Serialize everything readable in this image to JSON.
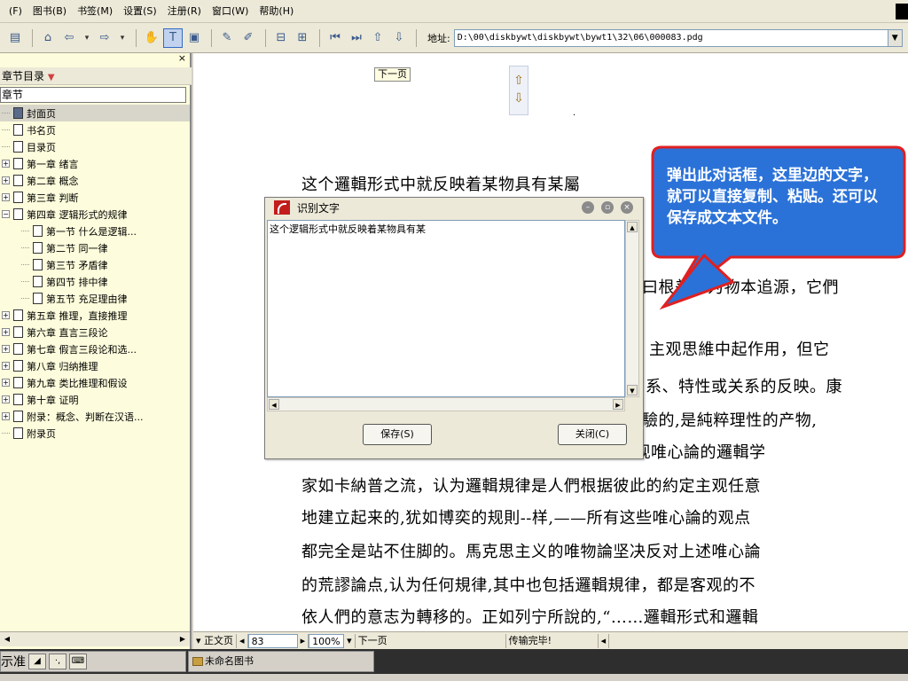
{
  "menu": {
    "items": [
      "(F)",
      "图书(B)",
      "书签(M)",
      "设置(S)",
      "注册(R)",
      "窗口(W)",
      "帮助(H)"
    ]
  },
  "toolbar": {
    "address_label": "地址:",
    "address_value": "D:\\00\\diskbywt\\diskbywt\\bywt1\\32\\06\\000083.pdg"
  },
  "left_panel": {
    "title": "章节目录",
    "header": "章节",
    "tree": [
      {
        "label": "封面页",
        "expandable": false,
        "level": 0,
        "selected": true
      },
      {
        "label": "书名页",
        "expandable": false,
        "level": 0
      },
      {
        "label": "目录页",
        "expandable": false,
        "level": 0
      },
      {
        "label": "第一章 绪言",
        "expandable": true,
        "level": 0
      },
      {
        "label": "第二章 概念",
        "expandable": true,
        "level": 0
      },
      {
        "label": "第三章 判断",
        "expandable": true,
        "level": 0
      },
      {
        "label": "第四章 逻辑形式的规律",
        "expandable": true,
        "expanded": true,
        "level": 0
      },
      {
        "label": "第一节 什么是逻辑...",
        "expandable": false,
        "level": 1
      },
      {
        "label": "第二节 同一律",
        "expandable": false,
        "level": 1
      },
      {
        "label": "第三节 矛盾律",
        "expandable": false,
        "level": 1
      },
      {
        "label": "第四节 排中律",
        "expandable": false,
        "level": 1
      },
      {
        "label": "第五节 充足理由律",
        "expandable": false,
        "level": 1
      },
      {
        "label": "第五章 推理，直接推理",
        "expandable": true,
        "level": 0
      },
      {
        "label": "第六章 直言三段论",
        "expandable": true,
        "level": 0
      },
      {
        "label": "第七章 假言三段论和选...",
        "expandable": true,
        "level": 0
      },
      {
        "label": "第八章 归纳推理",
        "expandable": true,
        "level": 0
      },
      {
        "label": "第九章 类比推理和假设",
        "expandable": true,
        "level": 0
      },
      {
        "label": "第十章 证明",
        "expandable": true,
        "level": 0
      },
      {
        "label": "附录：概念、判断在汉语...",
        "expandable": true,
        "level": 0
      },
      {
        "label": "附录页",
        "expandable": false,
        "level": 0
      }
    ]
  },
  "document": {
    "next_page_hint": "下一页",
    "lines": [
      "这个邏輯形式中就反映着某物具有某屬",
      "曰根差，为物本追源，它們",
      "主观思維中起作用，但它",
      "系、特性或关系的反映。康",
      "驗的,是純粹理性的产物,",
      "級的主观唯心論的邏輯学",
      "家如卡納普之流，认为邏輯規律是人們根据彼此的約定主观任意",
      "地建立起来的,犹如博奕的规則--样,——所有这些唯心論的观点",
      "都完全是站不住脚的。馬克思主义的唯物論坚决反对上述唯心論",
      "的荒謬論点,认为任何規律,其中也包括邏輯規律，都是客观的不",
      "依人們的意志为轉移的。正如列宁所說的,“……邏輯形式和邏輯"
    ]
  },
  "dialog": {
    "title": "识别文字",
    "text": "这个逻辑形式中就反映着某物具有某",
    "save_label": "保存(S)",
    "close_label": "关闭(C)"
  },
  "callout": {
    "text": "弹出此对话框，这里边的文字，就可以直接复制、粘贴。还可以保存成文本文件。",
    "fill_color": "#2b72d8",
    "border_color": "#e02020"
  },
  "statusbar": {
    "mode": "正文页",
    "page": "83",
    "zoom": "100%",
    "next": "下一页",
    "status_text": "传输完毕!"
  },
  "taskbar": {
    "ime_label": "示准",
    "task_label": "未命名图书"
  }
}
